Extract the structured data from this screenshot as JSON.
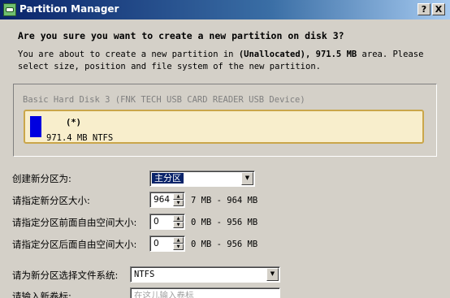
{
  "window": {
    "title": "Partition Manager",
    "help_label": "?",
    "close_label": "X"
  },
  "header": {
    "question": "Are you sure you want to create a new partition on disk 3?",
    "desc_pre": "You are about to create a new partition in ",
    "desc_area": "(Unallocated), 971.5 MB",
    "desc_post": " area. Please",
    "desc_line2": "select size, position and file system of the new partition."
  },
  "disk_map": {
    "label": "Basic Hard Disk 3 (FNK TECH  USB CARD READER USB Device)",
    "partition_mark": "(*)",
    "partition_info": "971.4 MB NTFS",
    "colors": {
      "partition": "#0000e0",
      "bar_bg": "#f8eecc",
      "bar_border": "#caa64a"
    }
  },
  "form": {
    "partition_type": {
      "label": "创建新分区为:",
      "value": "主分区"
    },
    "size": {
      "label": "请指定新分区大小:",
      "value": "964",
      "range": "7 MB - 964 MB"
    },
    "space_before": {
      "label": "请指定分区前面自由空间大小:",
      "value": "0",
      "range": "0 MB - 956 MB"
    },
    "space_after": {
      "label": "请指定分区后面自由空间大小:",
      "value": "0",
      "range": "0 MB - 956 MB"
    },
    "filesystem": {
      "label": "请为新分区选择文件系统:",
      "value": "NTFS"
    },
    "volume_label": {
      "label": "请输入新卷标:",
      "placeholder": "在这儿输入卷标"
    }
  }
}
